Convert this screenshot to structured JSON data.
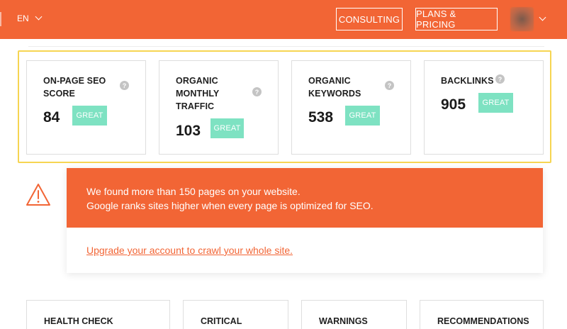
{
  "header": {
    "language": "EN",
    "consulting_label": "CONSULTING",
    "plans_label": "PLANS & PRICING",
    "brand_color": "#f26535"
  },
  "metrics": [
    {
      "title_lines": [
        "ON-PAGE SEO",
        "SCORE"
      ],
      "value": "84",
      "badge": "GREAT",
      "help": "?"
    },
    {
      "title_lines": [
        "ORGANIC",
        "MONTHLY",
        "TRAFFIC"
      ],
      "value": "103",
      "badge": "GREAT",
      "help": "?"
    },
    {
      "title_lines": [
        "ORGANIC",
        "KEYWORDS"
      ],
      "value": "538",
      "badge": "GREAT",
      "help": "?"
    },
    {
      "title_lines": [
        "BACKLINKS"
      ],
      "value": "905",
      "badge": "GREAT",
      "help": "?"
    }
  ],
  "alert": {
    "line1": "We found more than 150 pages on your website.",
    "line2": "Google ranks sites higher when every page is optimized for SEO.",
    "link": "Upgrade your account to crawl your whole site."
  },
  "sections": [
    "HEALTH CHECK",
    "CRITICAL",
    "WARNINGS",
    "RECOMMENDATIONS"
  ],
  "colors": {
    "accent": "#f26535",
    "highlight": "#f6d552",
    "badge": "#7ee2c2",
    "help": "#c4c4c4"
  }
}
